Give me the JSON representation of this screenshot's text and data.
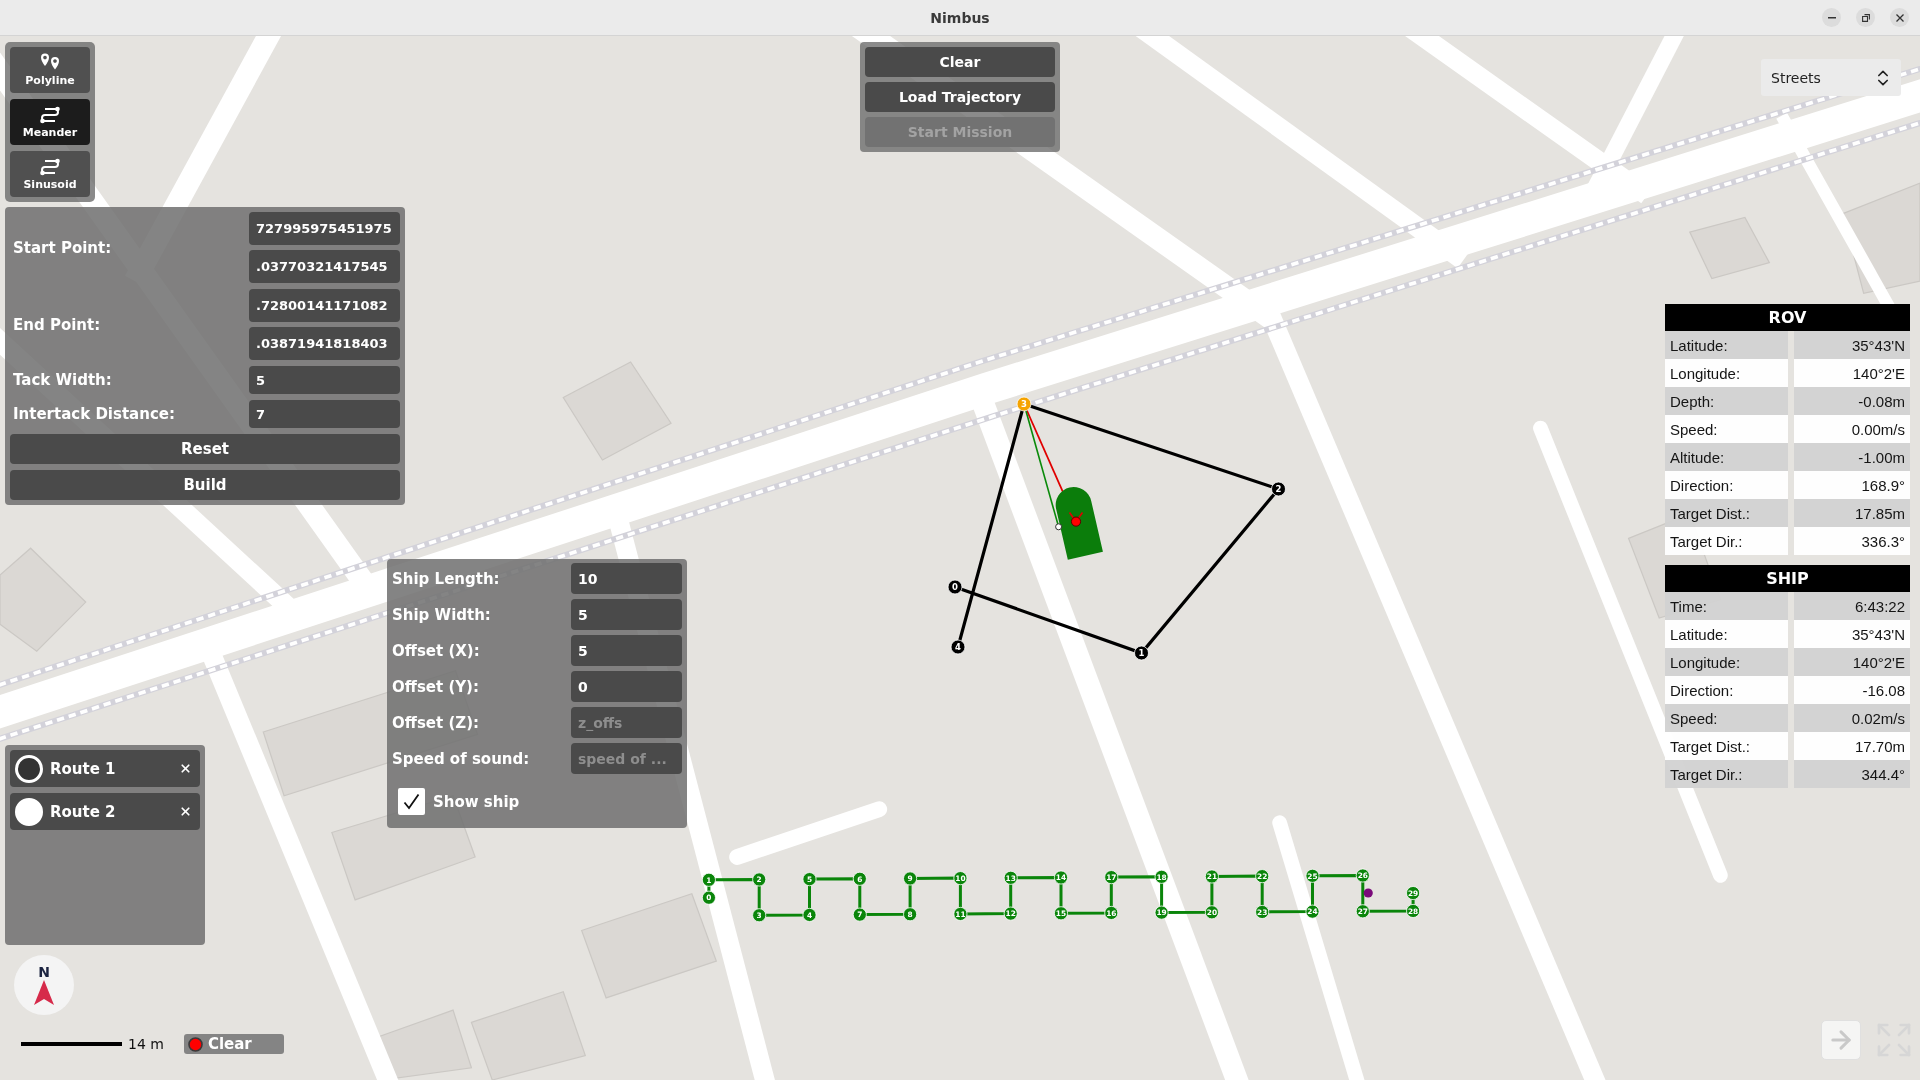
{
  "window": {
    "title": "Nimbus"
  },
  "tools": [
    {
      "label": "Polyline",
      "kind": "polyline",
      "selected": false
    },
    {
      "label": "Meander",
      "kind": "meander",
      "selected": true
    },
    {
      "label": "Sinusoid",
      "kind": "sinusoid",
      "selected": false
    }
  ],
  "meander_form": {
    "rows": [
      {
        "label": "Start Point:",
        "values": [
          "727995975451975",
          ".03770321417545"
        ]
      },
      {
        "label": "End Point:",
        "values": [
          ".72800141171082",
          ".03871941818403"
        ]
      },
      {
        "label": "Tack Width:",
        "values": [
          "5"
        ]
      },
      {
        "label": "Intertack Distance:",
        "values": [
          "7"
        ]
      }
    ],
    "buttons": [
      "Reset",
      "Build"
    ]
  },
  "mission_buttons": [
    {
      "label": "Clear",
      "disabled": false
    },
    {
      "label": "Load Trajectory",
      "disabled": false
    },
    {
      "label": "Start Mission",
      "disabled": true
    }
  ],
  "map_layer": {
    "value": "Streets"
  },
  "telemetry": [
    {
      "title": "ROV",
      "rows": [
        {
          "label": "Latitude:",
          "value": "35°43'N"
        },
        {
          "label": "Longitude:",
          "value": "140°2'E"
        },
        {
          "label": "Depth:",
          "value": "-0.08m"
        },
        {
          "label": "Speed:",
          "value": "0.00m/s"
        },
        {
          "label": "Altitude:",
          "value": "-1.00m"
        },
        {
          "label": "Direction:",
          "value": "168.9°"
        },
        {
          "label": "Target Dist.:",
          "value": "17.85m"
        },
        {
          "label": "Target Dir.:",
          "value": "336.3°"
        }
      ]
    },
    {
      "title": "SHIP",
      "rows": [
        {
          "label": "Time:",
          "value": "6:43:22"
        },
        {
          "label": "Latitude:",
          "value": "35°43'N"
        },
        {
          "label": "Longitude:",
          "value": "140°2'E"
        },
        {
          "label": "Direction:",
          "value": "-16.08"
        },
        {
          "label": "Speed:",
          "value": "0.02m/s"
        },
        {
          "label": "Target Dist.:",
          "value": "17.70m"
        },
        {
          "label": "Target Dir.:",
          "value": "344.4°"
        }
      ]
    }
  ],
  "ship_settings": {
    "fields": [
      {
        "label": "Ship Length:",
        "value": "10"
      },
      {
        "label": "Ship Width:",
        "value": "5"
      },
      {
        "label": "Offset (X):",
        "value": "5"
      },
      {
        "label": "Offset (Y):",
        "value": "0"
      },
      {
        "label": "Offset (Z):",
        "placeholder": "z_offs"
      },
      {
        "label": "Speed of sound:",
        "placeholder": "speed of ..."
      }
    ],
    "show_ship": {
      "label": "Show ship",
      "checked": true
    }
  },
  "routes": [
    {
      "name": "Route 1",
      "selected": true
    },
    {
      "name": "Route 2",
      "selected": false
    }
  ],
  "compass": {
    "label": "N"
  },
  "scale": {
    "label": "14 m"
  },
  "track": {
    "clear_label": "Clear"
  },
  "mission_map": {
    "polygon_route": [
      {
        "label": "0",
        "active": false
      },
      {
        "label": "1",
        "active": false
      },
      {
        "label": "2",
        "active": false
      },
      {
        "label": "3",
        "active": true
      },
      {
        "label": "4",
        "active": false
      }
    ],
    "meander_route": [
      "0",
      "1",
      "2",
      "3",
      "4",
      "5",
      "6",
      "7",
      "8",
      "9",
      "10",
      "11",
      "12",
      "13",
      "14",
      "15",
      "16",
      "17",
      "18",
      "19",
      "20",
      "21",
      "22",
      "23",
      "24",
      "25",
      "26",
      "27",
      "28",
      "29"
    ]
  }
}
